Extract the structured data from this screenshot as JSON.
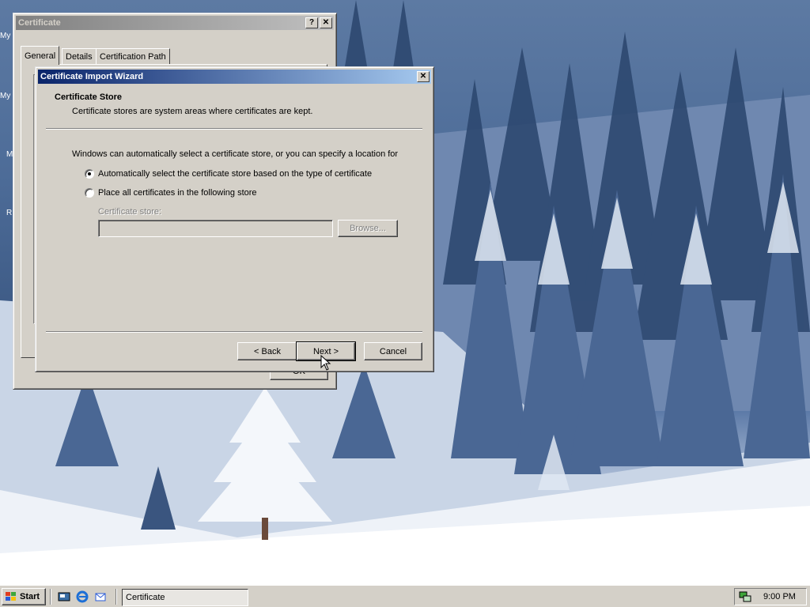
{
  "desktop": {
    "icon_labels": [
      "My",
      "My",
      "M",
      "R"
    ]
  },
  "cert_window": {
    "title": "Certificate",
    "help_btn": "?",
    "close_btn": "✕",
    "tabs": [
      "General",
      "Details",
      "Certification Path"
    ],
    "ok_label": "OK"
  },
  "wizard": {
    "title": "Certificate Import Wizard",
    "close_btn": "✕",
    "heading": "Certificate Store",
    "subheading": "Certificate stores are system areas where certificates are kept.",
    "intro": "Windows can automatically select a certificate store, or you can specify a location for",
    "option_auto": "Automatically select the certificate store based on the type of certificate",
    "option_manual": "Place all certificates in the following store",
    "store_label": "Certificate store:",
    "store_value": "",
    "browse_label": "Browse...",
    "back_label": "< Back",
    "next_label": "Next >",
    "cancel_label": "Cancel",
    "selected_option": "auto"
  },
  "taskbar": {
    "start_label": "Start",
    "task_label": "Certificate",
    "clock": "9:00 PM"
  }
}
